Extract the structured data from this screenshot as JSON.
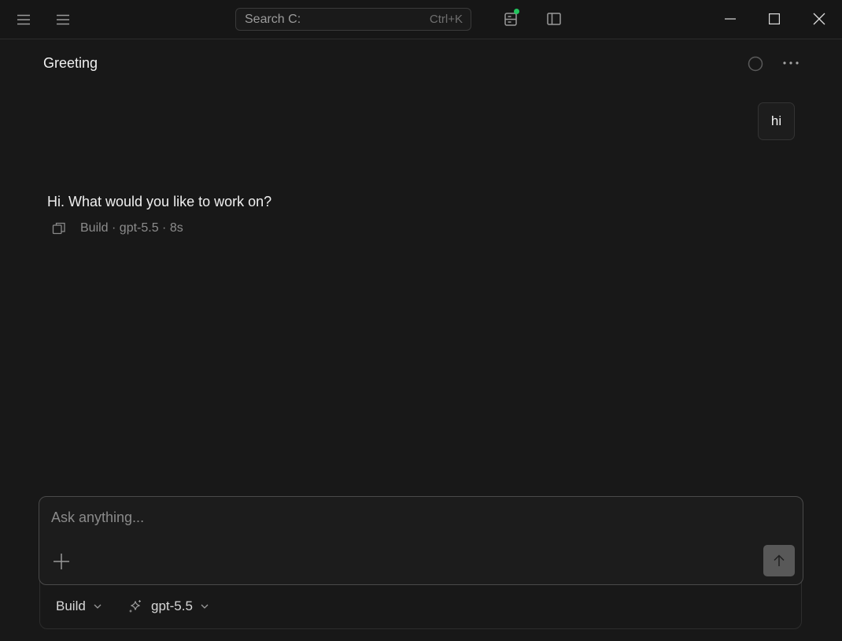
{
  "search": {
    "placeholder": "Search C:",
    "shortcut": "Ctrl+K"
  },
  "thread": {
    "title": "Greeting"
  },
  "messages": {
    "user_text": "hi",
    "assistant_text": "Hi. What would you like to work on?",
    "assistant_meta": "Build · gpt-5.5 · 8s"
  },
  "composer": {
    "placeholder": "Ask anything..."
  },
  "footer": {
    "mode_label": "Build",
    "model_label": "gpt-5.5"
  },
  "icons": {
    "menu": "hamburger-icon",
    "server": "server-icon",
    "sidebar": "sidebar-toggle-icon",
    "minimize": "minimize-icon",
    "maximize": "maximize-icon",
    "close": "close-icon",
    "status": "circle-icon",
    "more": "more-icon",
    "copy": "copy-icon",
    "attach": "plus-icon",
    "send": "arrow-up-icon",
    "model": "sparkle-icon",
    "dropdown": "chevron-down-icon"
  },
  "colors": {
    "background": "#181818",
    "status_online": "#22c55e",
    "send_button": "#585858"
  }
}
